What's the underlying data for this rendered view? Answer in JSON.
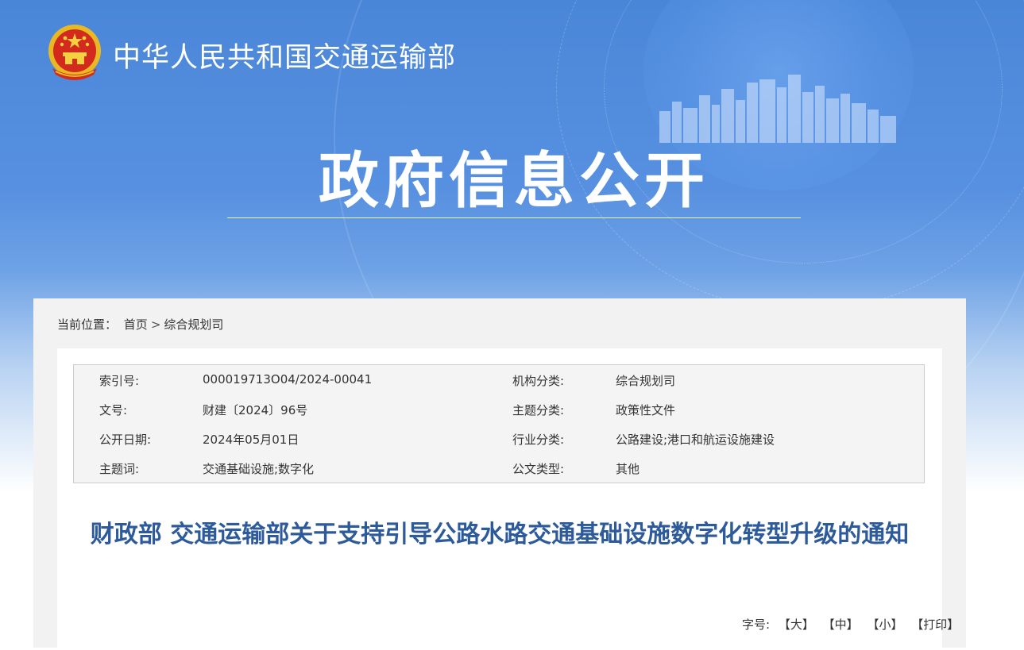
{
  "header": {
    "site_name": "中华人民共和国交通运输部",
    "section_title": "政府信息公开"
  },
  "breadcrumb": {
    "prefix": "当前位置：",
    "items": [
      "首页",
      "综合规划司"
    ],
    "separator": ">"
  },
  "meta": {
    "rows": [
      {
        "k1": "索引号:",
        "v1": "000019713O04/2024-00041",
        "k2": "机构分类:",
        "v2": "综合规划司"
      },
      {
        "k1": "文号:",
        "v1": "财建〔2024〕96号",
        "k2": "主题分类:",
        "v2": "政策性文件"
      },
      {
        "k1": "公开日期:",
        "v1": "2024年05月01日",
        "k2": "行业分类:",
        "v2": "公路建设;港口和航运设施建设"
      },
      {
        "k1": "主题词:",
        "v1": "交通基础设施;数字化",
        "k2": "公文类型:",
        "v2": "其他"
      }
    ]
  },
  "article": {
    "title": "财政部 交通运输部关于支持引导公路水路交通基础设施数字化转型升级的通知"
  },
  "font_tools": {
    "label": "字号:",
    "large": "【大】",
    "medium": "【中】",
    "small": "【小】",
    "print": "【打印】"
  },
  "colors": {
    "banner_blue": "#4a86d8",
    "title_blue": "#2d5a9a",
    "panel_gray": "#f2f2f2"
  },
  "icons": {
    "emblem": "national-emblem-icon",
    "skyline": "city-skyline-decoration"
  }
}
